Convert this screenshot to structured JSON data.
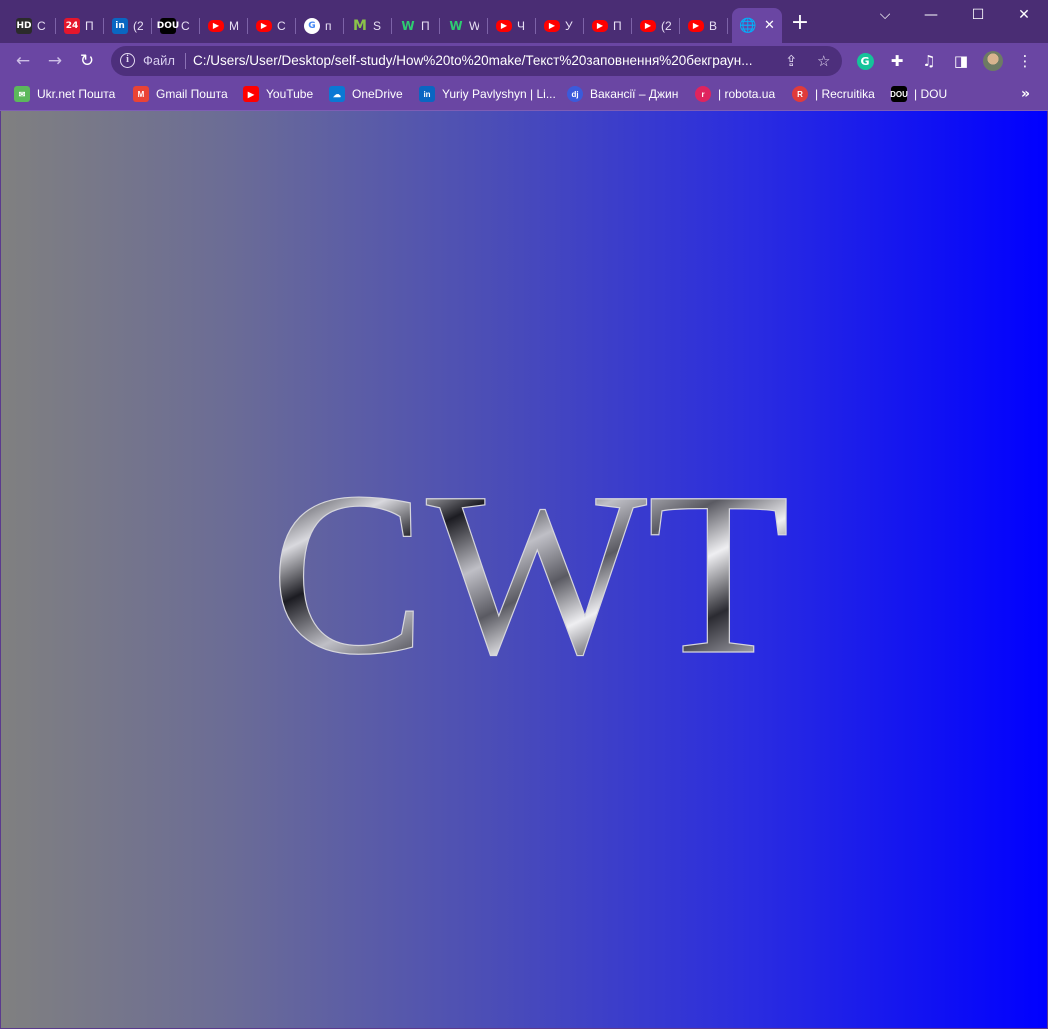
{
  "tabs": [
    {
      "icon": "hd-icon",
      "badge": "HD",
      "color": "#2b2b2b",
      "title": "С"
    },
    {
      "icon": "news24-icon",
      "badge": "24",
      "color": "#e5162c",
      "title": "П"
    },
    {
      "icon": "linkedin-icon",
      "badge": "in",
      "color": "#0a66c2",
      "title": "(2"
    },
    {
      "icon": "dou-icon",
      "badge": "DOU",
      "color": "#000000",
      "title": "С"
    },
    {
      "icon": "youtube-icon",
      "badge": "▶",
      "color": "#ff0000",
      "title": "М"
    },
    {
      "icon": "youtube-icon",
      "badge": "▶",
      "color": "#ff0000",
      "title": "С"
    },
    {
      "icon": "google-icon",
      "badge": "G",
      "color": "#ffffff",
      "title": "п"
    },
    {
      "icon": "m-icon",
      "badge": "M",
      "color": "#8bc34a",
      "title": "S"
    },
    {
      "icon": "w-icon",
      "badge": "W",
      "color": "#1a7f4b",
      "title": "П"
    },
    {
      "icon": "w-icon",
      "badge": "W",
      "color": "#1a7f4b",
      "title": "W"
    },
    {
      "icon": "youtube-icon",
      "badge": "▶",
      "color": "#ff0000",
      "title": "Ч"
    },
    {
      "icon": "youtube-icon",
      "badge": "▶",
      "color": "#ff0000",
      "title": "У"
    },
    {
      "icon": "youtube-icon",
      "badge": "▶",
      "color": "#ff0000",
      "title": "П"
    },
    {
      "icon": "youtube-icon",
      "badge": "▶",
      "color": "#ff0000",
      "title": "(2"
    },
    {
      "icon": "youtube-icon",
      "badge": "▶",
      "color": "#ff0000",
      "title": "В"
    }
  ],
  "active_tab": {
    "icon": "globe-icon"
  },
  "window_controls": {
    "tab_search": "⌵",
    "minimize": "—",
    "maximize": "☐",
    "close": "✕"
  },
  "toolbar": {
    "scheme": "Файл",
    "url": "C:/Users/User/Desktop/self-study/How%20to%20make/Текст%20заповнення%20бекграун..."
  },
  "bookmarks": [
    {
      "label": "Ukr.net Пошта",
      "icon": "ukrnet-icon",
      "color": "#5cb85c",
      "badge": "✉"
    },
    {
      "label": "Gmail Пошта",
      "icon": "gmail-icon",
      "color": "#ea4335",
      "badge": "M"
    },
    {
      "label": "YouTube",
      "icon": "youtube-icon",
      "color": "#ff0000",
      "badge": "▶"
    },
    {
      "label": "OneDrive",
      "icon": "onedrive-icon",
      "color": "#0a78d4",
      "badge": "☁"
    },
    {
      "label": "Yuriy Pavlyshyn | Li...",
      "icon": "linkedin-icon",
      "color": "#0a66c2",
      "badge": "in"
    },
    {
      "label": "Вакансії – Джин",
      "icon": "djinni-icon",
      "color": "#3b5bdb",
      "badge": "dj"
    },
    {
      "label": "| robota.ua",
      "icon": "robota-icon",
      "color": "#e0245e",
      "badge": "r"
    },
    {
      "label": "| Recruitika",
      "icon": "recruitika-icon",
      "color": "#e03b3b",
      "badge": "R"
    },
    {
      "label": "| DOU",
      "icon": "dou-icon",
      "color": "#000000",
      "badge": "DOU"
    }
  ],
  "page": {
    "heading": "CWT"
  }
}
